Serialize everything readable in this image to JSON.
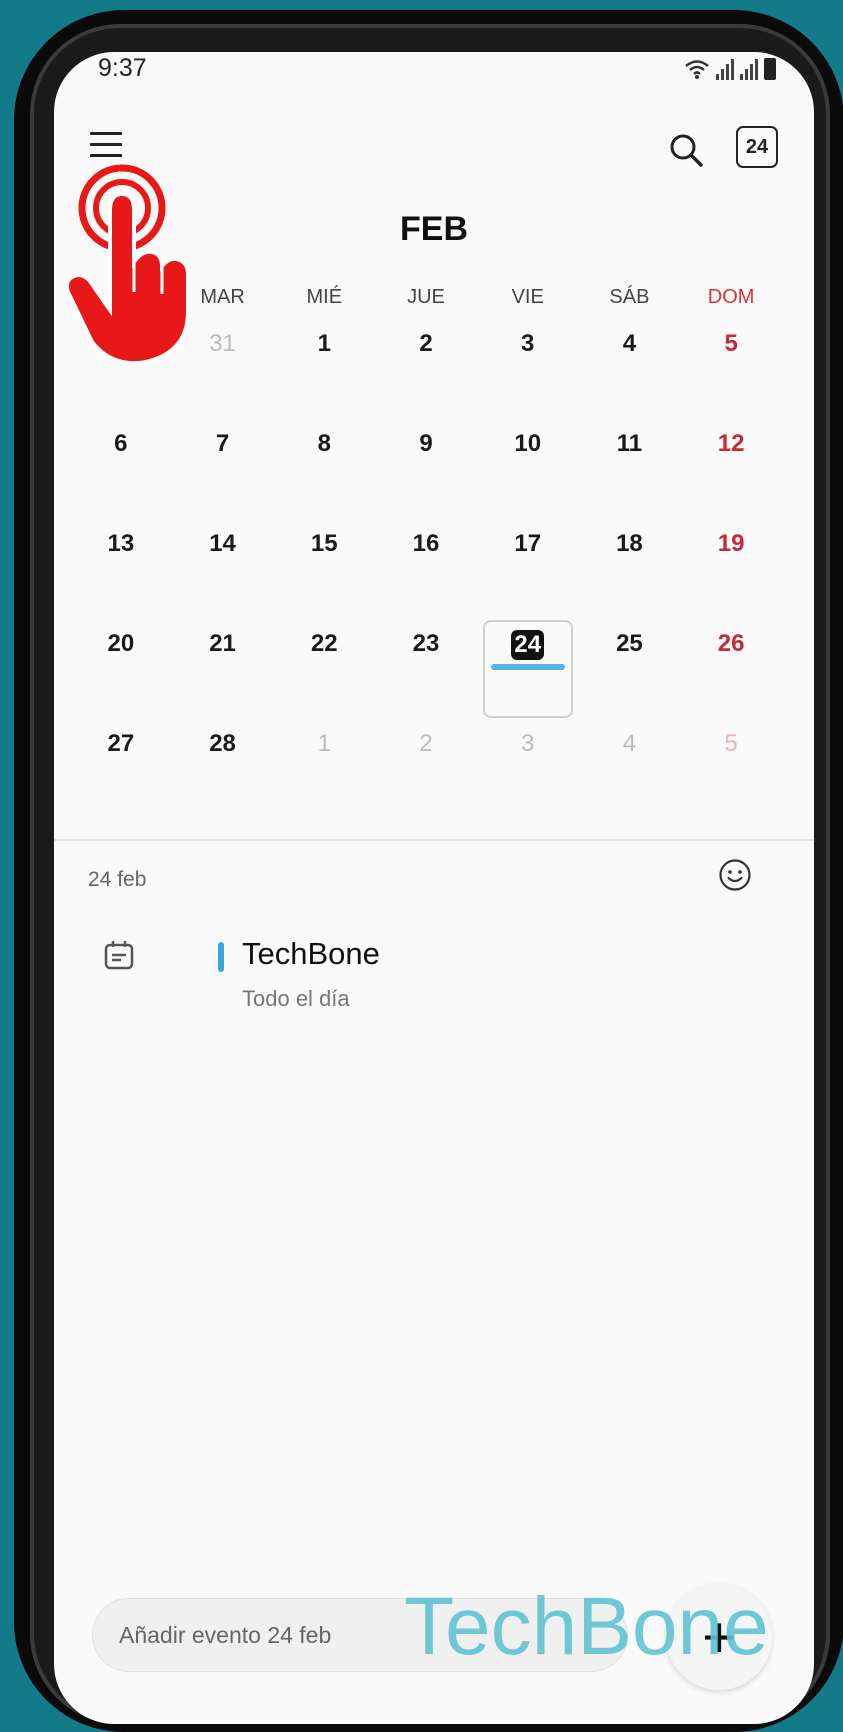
{
  "status": {
    "time": "9:37"
  },
  "header": {
    "today_number": "24",
    "month": "FEB"
  },
  "weekdays": [
    "",
    "MAR",
    "MIÉ",
    "JUE",
    "VIE",
    "SÁB",
    "DOM"
  ],
  "calendar": {
    "weeks": [
      [
        {
          "d": ""
        },
        {
          "d": "31",
          "muted": true
        },
        {
          "d": "1"
        },
        {
          "d": "2"
        },
        {
          "d": "3"
        },
        {
          "d": "4"
        },
        {
          "d": "5",
          "sun": true
        }
      ],
      [
        {
          "d": "6"
        },
        {
          "d": "7"
        },
        {
          "d": "8"
        },
        {
          "d": "9"
        },
        {
          "d": "10"
        },
        {
          "d": "11"
        },
        {
          "d": "12",
          "sun": true
        }
      ],
      [
        {
          "d": "13"
        },
        {
          "d": "14"
        },
        {
          "d": "15"
        },
        {
          "d": "16"
        },
        {
          "d": "17"
        },
        {
          "d": "18"
        },
        {
          "d": "19",
          "sun": true
        }
      ],
      [
        {
          "d": "20"
        },
        {
          "d": "21"
        },
        {
          "d": "22"
        },
        {
          "d": "23"
        },
        {
          "d": "24",
          "today": true,
          "event": true
        },
        {
          "d": "25"
        },
        {
          "d": "26",
          "sun": true
        }
      ],
      [
        {
          "d": "27"
        },
        {
          "d": "28"
        },
        {
          "d": "1",
          "muted": true
        },
        {
          "d": "2",
          "muted": true
        },
        {
          "d": "3",
          "muted": true
        },
        {
          "d": "4",
          "muted": true
        },
        {
          "d": "5",
          "sun": true,
          "muted": true
        }
      ]
    ]
  },
  "events_panel": {
    "selected_date": "24 feb",
    "events": [
      {
        "title": "TechBone",
        "subtitle": "Todo el día",
        "color": "#3aa6e0"
      }
    ]
  },
  "add_event": {
    "placeholder": "Añadir evento 24 feb",
    "fab_label": "+"
  },
  "watermark": "TechBone",
  "colors": {
    "sunday": "#c8283a",
    "event_bar": "#5ab4e6",
    "background": "#137a8a",
    "pointer_hand": "#e81818"
  }
}
